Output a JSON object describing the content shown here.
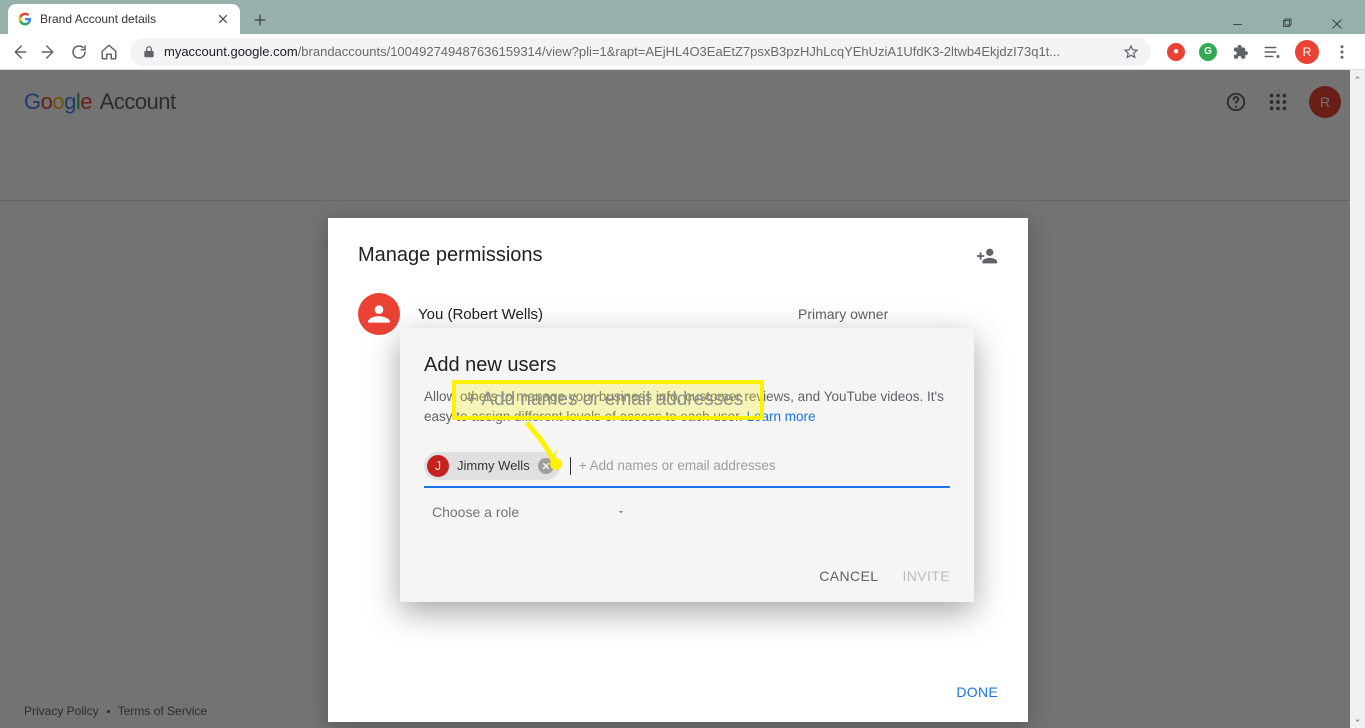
{
  "browser": {
    "tab_title": "Brand Account details",
    "url_domain": "myaccount.google.com",
    "url_path": "/brandaccounts/100492749487636159314/view?pli=1&rapt=AEjHL4O3EaEtZ7psxB3pzHJhLcqYEhUziA1UfdK3-2ltwb4EkjdzI73q1t...",
    "avatar_letter": "R"
  },
  "header": {
    "logo_text": "Google",
    "account_text": "Account",
    "avatar_letter": "R"
  },
  "panel": {
    "title": "Manage permissions",
    "user_name": "You (Robert Wells)",
    "user_role": "Primary owner",
    "done": "DONE"
  },
  "modal": {
    "title": "Add new users",
    "desc_a": "Allow others to manage your business info, customer reviews, and YouTube videos. It's easy to assign different levels of access to each user. ",
    "learn_more": "Learn more",
    "chip_name": "Jimmy Wells",
    "chip_letter": "J",
    "placeholder": "+ Add names or email addresses",
    "role_label": "Choose a role",
    "cancel": "CANCEL",
    "invite": "INVITE"
  },
  "highlight": {
    "text": "+ Add names or email addresses"
  },
  "footer": {
    "privacy": "Privacy Policy",
    "terms": "Terms of Service"
  }
}
